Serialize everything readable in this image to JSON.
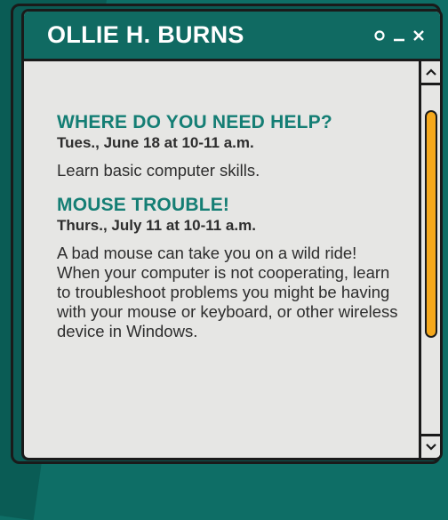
{
  "window": {
    "title": "OLLIE H. BURNS"
  },
  "events": [
    {
      "title": "WHERE DO YOU NEED HELP?",
      "date": "Tues., June 18 at 10-11 a.m.",
      "description": "Learn basic computer skills."
    },
    {
      "title": "MOUSE TROUBLE!",
      "date": "Thurs., July 11 at 10-11 a.m.",
      "description": "A bad mouse can take you on a wild ride! When your computer is not cooperating, learn to troubleshoot problems you might be having with your mouse or keyboard, or other wireless device in Windows."
    }
  ],
  "colors": {
    "background": "#0e6e66",
    "titlebar": "#106a62",
    "accent_text": "#147e74",
    "scroll_thumb": "#f5a81c",
    "panel": "#e6e6e4"
  },
  "icons": [
    "restore-icon",
    "minimize-icon",
    "close-icon",
    "chevron-up-icon",
    "chevron-down-icon"
  ]
}
